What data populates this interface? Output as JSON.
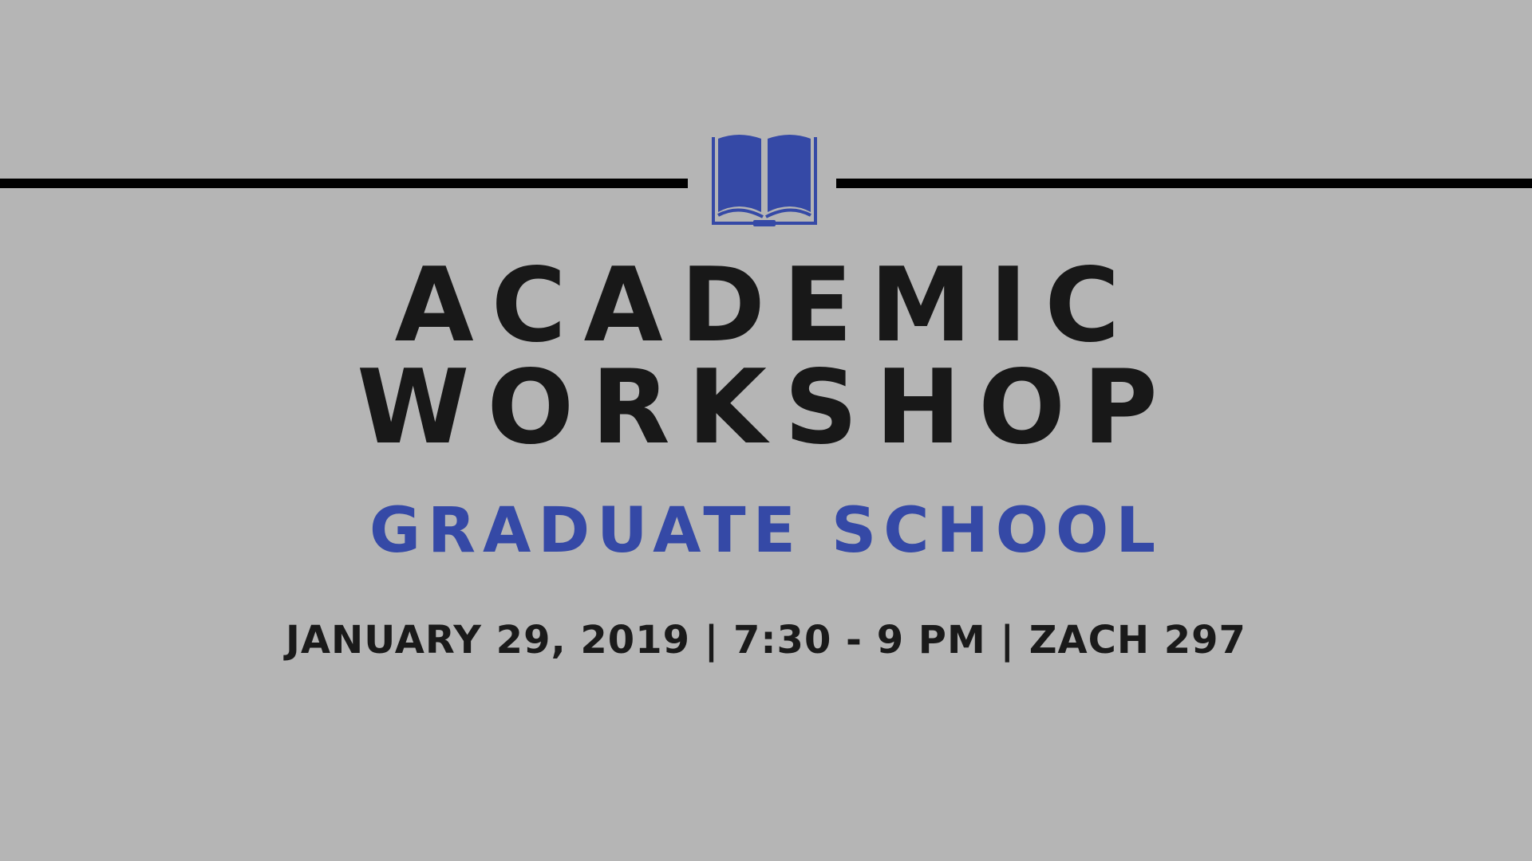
{
  "colors": {
    "background": "#b5b5b5",
    "rule": "#000000",
    "accent": "#3549a6",
    "text": "#181818"
  },
  "icon": "open-book-icon",
  "title_line1": "ACADEMIC",
  "title_line2": "WORKSHOP",
  "subtitle": "GRADUATE SCHOOL",
  "details": "JANUARY 29, 2019 | 7:30 - 9 PM | ZACH 297"
}
